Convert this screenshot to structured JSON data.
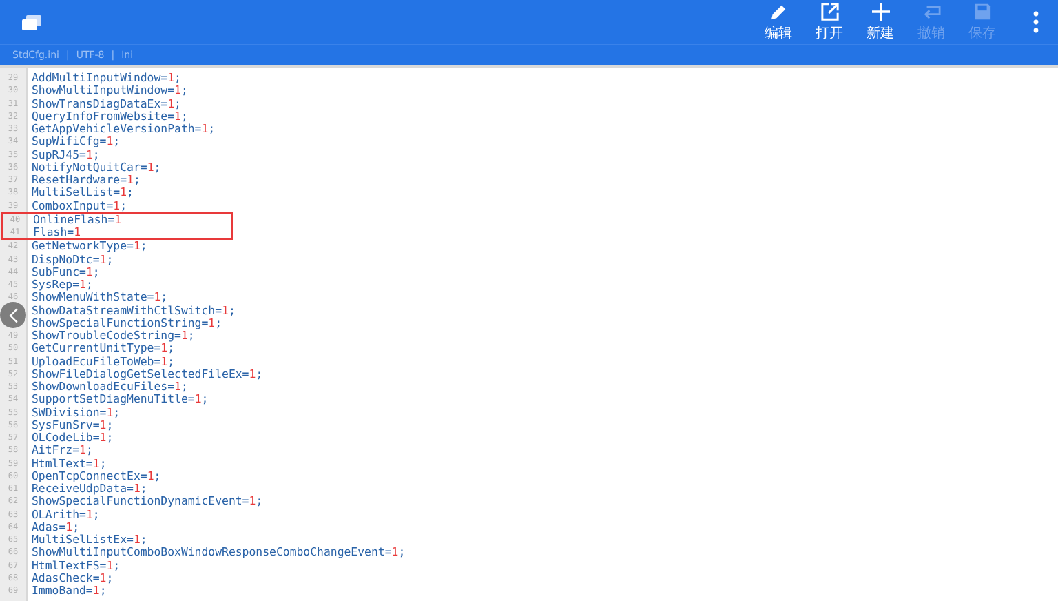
{
  "toolbar": {
    "actions": [
      {
        "label": "编辑",
        "disabled": false
      },
      {
        "label": "打开",
        "disabled": false
      },
      {
        "label": "新建",
        "disabled": false
      },
      {
        "label": "撤销",
        "disabled": true
      },
      {
        "label": "保存",
        "disabled": true
      }
    ]
  },
  "file_info": {
    "name": "StdCfg.ini",
    "encoding": "UTF-8",
    "syntax": "Ini",
    "separator": "|"
  },
  "lines": [
    {
      "n": "29",
      "key": "AddMultiInputWindow=",
      "value": "1",
      "end": ";",
      "marked": false
    },
    {
      "n": "30",
      "key": "ShowMultiInputWindow=",
      "value": "1",
      "end": ";",
      "marked": false
    },
    {
      "n": "31",
      "key": "ShowTransDiagDataEx=",
      "value": "1",
      "end": ";",
      "marked": false
    },
    {
      "n": "32",
      "key": "QueryInfoFromWebsite=",
      "value": "1",
      "end": ";",
      "marked": false
    },
    {
      "n": "33",
      "key": "GetAppVehicleVersionPath=",
      "value": "1",
      "end": ";",
      "marked": false
    },
    {
      "n": "34",
      "key": "SupWifiCfg=",
      "value": "1",
      "end": ";",
      "marked": false
    },
    {
      "n": "35",
      "key": "SupRJ45=",
      "value": "1",
      "end": ";",
      "marked": false
    },
    {
      "n": "36",
      "key": "NotifyNotQuitCar=",
      "value": "1",
      "end": ";",
      "marked": false
    },
    {
      "n": "37",
      "key": "ResetHardware=",
      "value": "1",
      "end": ";",
      "marked": false
    },
    {
      "n": "38",
      "key": "MultiSelList=",
      "value": "1",
      "end": ";",
      "marked": false
    },
    {
      "n": "39",
      "key": "ComboxInput=",
      "value": "1",
      "end": ";",
      "marked": false
    },
    {
      "n": "40",
      "key": "OnlineFlash=",
      "value": "1",
      "marked": true
    },
    {
      "n": "41",
      "key": "Flash=",
      "value": "1",
      "marked": true
    },
    {
      "n": "42",
      "key": "GetNetworkType=",
      "value": "1",
      "end": ";",
      "marked": false
    },
    {
      "n": "43",
      "key": "DispNoDtc=",
      "value": "1",
      "end": ";",
      "marked": false
    },
    {
      "n": "44",
      "key": "SubFunc=",
      "value": "1",
      "end": ";",
      "marked": false
    },
    {
      "n": "45",
      "key": "SysRep=",
      "value": "1",
      "end": ";",
      "marked": false
    },
    {
      "n": "46",
      "key": "ShowMenuWithState=",
      "value": "1",
      "end": ";",
      "marked": false
    },
    {
      "key": "ShowDataStreamWithCtlSwitch=",
      "value": "1",
      "end": ";",
      "marked": false
    },
    {
      "key": "ShowSpecialFunctionString=",
      "value": "1",
      "end": ";",
      "marked": false
    },
    {
      "n": "49",
      "key": "ShowTroubleCodeString=",
      "value": "1",
      "end": ";",
      "marked": false
    },
    {
      "n": "50",
      "key": "GetCurrentUnitType=",
      "value": "1",
      "end": ";",
      "marked": false
    },
    {
      "n": "51",
      "key": "UploadEcuFileToWeb=",
      "value": "1",
      "end": ";",
      "marked": false
    },
    {
      "n": "52",
      "key": "ShowFileDialogGetSelectedFileEx=",
      "value": "1",
      "end": ";",
      "marked": false
    },
    {
      "n": "53",
      "key": "ShowDownloadEcuFiles=",
      "value": "1",
      "end": ";",
      "marked": false
    },
    {
      "n": "54",
      "key": "SupportSetDiagMenuTitle=",
      "value": "1",
      "end": ";",
      "marked": false
    },
    {
      "n": "55",
      "key": "SWDivision=",
      "value": "1",
      "end": ";",
      "marked": false
    },
    {
      "n": "56",
      "key": "SysFunSrv=",
      "value": "1",
      "end": ";",
      "marked": false
    },
    {
      "n": "57",
      "key": "OLCodeLib=",
      "value": "1",
      "end": ";",
      "marked": false
    },
    {
      "n": "58",
      "key": "AitFrz=",
      "value": "1",
      "end": ";",
      "marked": false
    },
    {
      "n": "59",
      "key": "HtmlText=",
      "value": "1",
      "end": ";",
      "marked": false
    },
    {
      "n": "60",
      "key": "OpenTcpConnectEx=",
      "value": "1",
      "end": ";",
      "marked": false
    },
    {
      "n": "61",
      "key": "ReceiveUdpData=",
      "value": "1",
      "end": ";",
      "marked": false
    },
    {
      "n": "62",
      "key": "ShowSpecialFunctionDynamicEvent=",
      "value": "1",
      "end": ";",
      "marked": false
    },
    {
      "n": "63",
      "key": "OLArith=",
      "value": "1",
      "end": ";",
      "marked": false
    },
    {
      "n": "64",
      "key": "Adas=",
      "value": "1",
      "end": ";",
      "marked": false
    },
    {
      "n": "65",
      "key": "MultiSelListEx=",
      "value": "1",
      "end": ";",
      "marked": false
    },
    {
      "n": "66",
      "key": "ShowMultiInputComboBoxWindowResponseComboChangeEvent=",
      "value": "1",
      "end": ";",
      "marked": false
    },
    {
      "n": "67",
      "key": "HtmlTextFS=",
      "value": "1",
      "end": ";",
      "marked": false
    },
    {
      "n": "68",
      "key": "AdasCheck=",
      "value": "1",
      "end": ";",
      "marked": false
    },
    {
      "n": "69",
      "key": "ImmoBand=",
      "value": "1",
      "end": ";",
      "marked": false
    }
  ]
}
